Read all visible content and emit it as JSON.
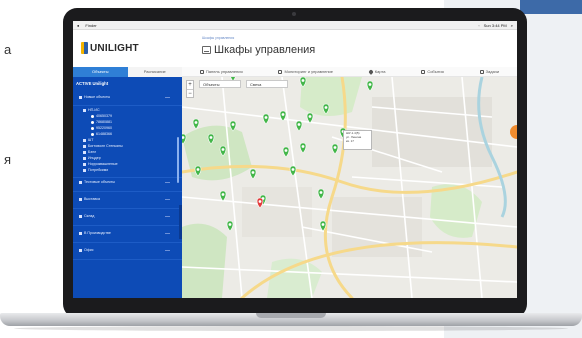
{
  "background": {
    "left_text_a": "а",
    "left_text_b": "я"
  },
  "menubar": {
    "app_name": "Finder",
    "clock": "Sun 3:44 PM"
  },
  "header": {
    "logo_text": "UNILIGHT",
    "breadcrumb": "Шкафы управления",
    "page_title": "Шкафы управления"
  },
  "sidebar": {
    "tabs": [
      {
        "label": "Объекты",
        "active": true
      },
      {
        "label": "Расписание",
        "active": false
      }
    ],
    "tree_header": "ACTIVE Unilight",
    "top_group": "Новые объекты",
    "sub_group": "НП-ИС",
    "leaf_ids": [
      "40650379",
      "78680881",
      "95220960",
      "61488366"
    ],
    "items": [
      "ШТ",
      "Бигтоволн Стеньяны",
      "Бэнл",
      "Инцдер",
      "Норроквашленые",
      "Потребкими"
    ],
    "sections": [
      "Тестовые объекты",
      "Выставка",
      "Склад",
      "В Производстве",
      "Офис"
    ]
  },
  "toolbar": {
    "items": [
      {
        "icon": "chart-icon",
        "label": "Панель управления"
      },
      {
        "icon": "monitor-icon",
        "label": "Мониторинг и управление"
      },
      {
        "icon": "map-pin-icon",
        "label": "Карта"
      },
      {
        "icon": "calendar-icon",
        "label": "События"
      },
      {
        "icon": "list-icon",
        "label": "Задачи"
      }
    ]
  },
  "map": {
    "zoom_in": "+",
    "zoom_out": "−",
    "filter_objects": "Объекты",
    "filter_lights": "Свеча",
    "colors": {
      "land": "#ecebe6",
      "park": "#cfe6c2",
      "road_major": "#f6d98a",
      "road_minor": "#ffffff",
      "marker_ok": "#43b649",
      "marker_alert": "#e23b3b",
      "marker_warn": "#9bc43a",
      "accent": "#2f7fd6"
    },
    "popup_lines": [
      "ШУ-1.4(5)",
      "ул. Ленина",
      "кв. 17"
    ]
  }
}
